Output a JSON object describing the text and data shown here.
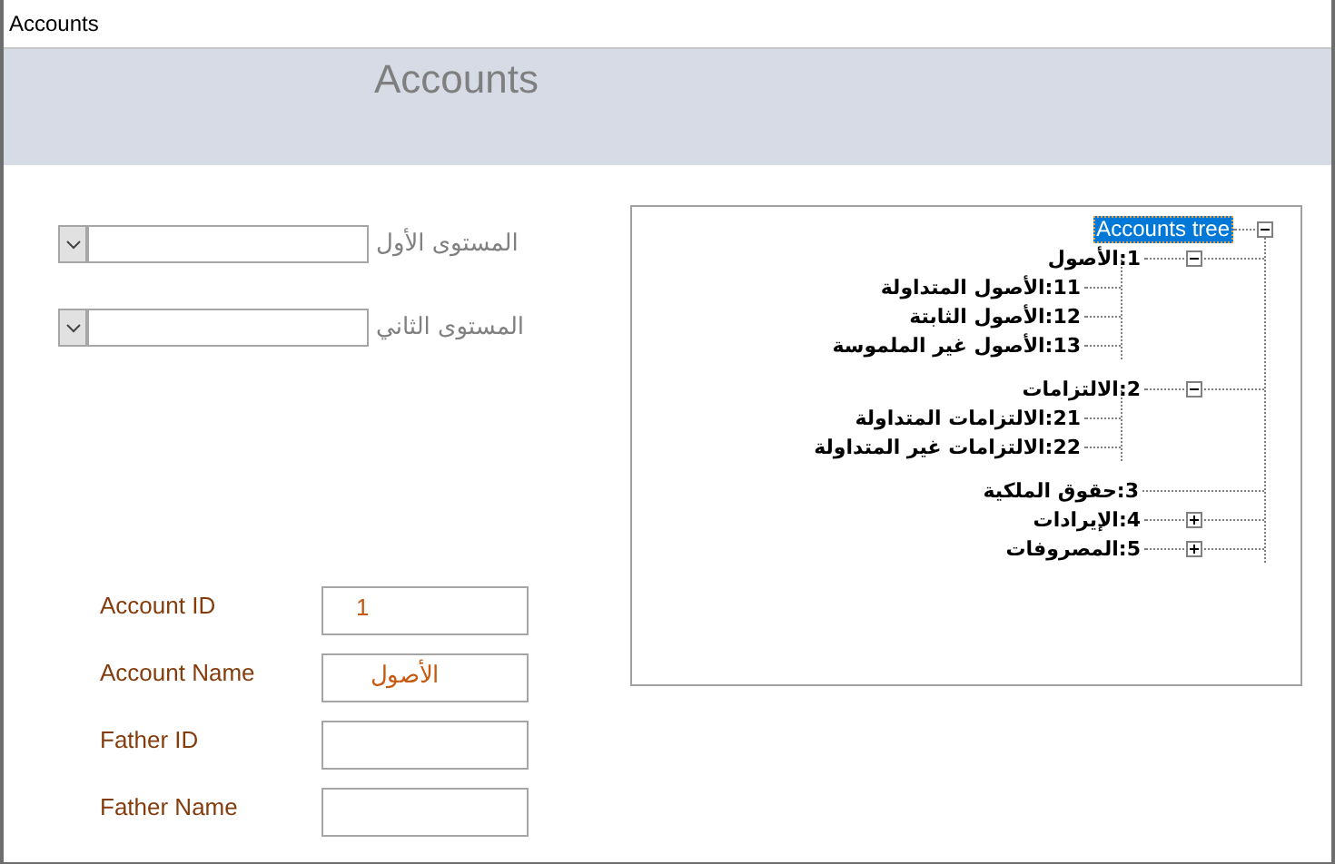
{
  "window": {
    "title": "Accounts"
  },
  "header": {
    "title": "Accounts"
  },
  "filters": [
    {
      "label": "المستوى الأول"
    },
    {
      "label": "المستوى الثاني"
    }
  ],
  "fields": [
    {
      "label": "Account ID",
      "value": "1"
    },
    {
      "label": "Account Name",
      "value": "الأصول"
    },
    {
      "label": "Father ID"
    },
    {
      "label": "Father Name"
    }
  ],
  "tree": {
    "label": "Accounts tree",
    "selected": true,
    "expanded": true,
    "children": [
      {
        "label": "1:الأصول",
        "selected": false,
        "expanded": true,
        "children": [
          {
            "label": "11:الأصول المتداولة",
            "selected": false
          },
          {
            "label": "12:الأصول الثابتة",
            "selected": false
          },
          {
            "label": "13:الأصول غير الملموسة",
            "selected": false
          }
        ]
      },
      {
        "label": "2:الالتزامات",
        "selected": false,
        "expanded": true,
        "children": [
          {
            "label": "21:الالتزامات المتداولة",
            "selected": false
          },
          {
            "label": "22:الالتزامات غير المتداولة",
            "selected": false
          }
        ]
      },
      {
        "label": "3:حقوق الملكية",
        "selected": false
      },
      {
        "label": "4:الإيرادات",
        "selected": false,
        "expanded": false
      },
      {
        "label": "5:المصروفات",
        "selected": false,
        "expanded": false
      }
    ]
  }
}
